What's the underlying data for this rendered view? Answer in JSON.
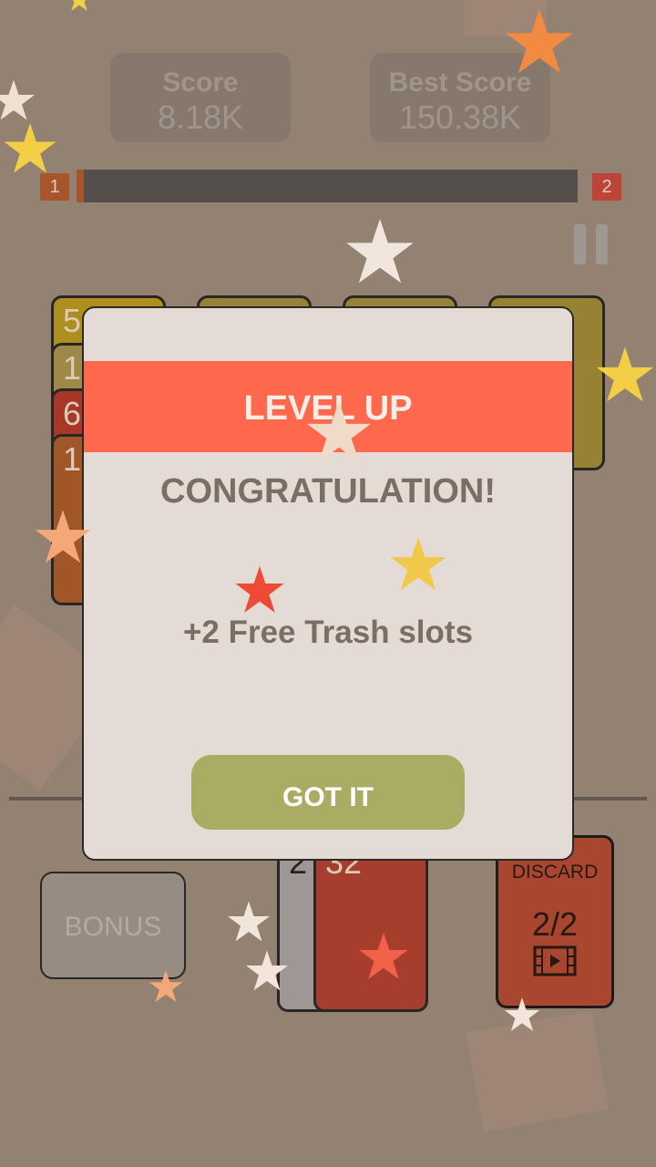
{
  "scoreboard": {
    "score_label": "Score",
    "score_value": "8.18K",
    "best_label": "Best Score",
    "best_value": "150.38K"
  },
  "level": {
    "current": "1",
    "next": "2",
    "progress_fraction": 0.015
  },
  "board_card_digits": [
    "5",
    "1",
    "6",
    "1"
  ],
  "dialog": {
    "title": "LEVEL UP",
    "heading": "CONGRATULATION!",
    "reward": "+2 Free Trash slots",
    "button": "GOT IT"
  },
  "hand": {
    "back_card_value": "2",
    "front_card_value": "32"
  },
  "bonus": {
    "label": "BONUS"
  },
  "discard": {
    "label": "DISCARD",
    "count": "2/2",
    "icon": "video-ad-icon"
  },
  "colors": {
    "banner": "#fe694e",
    "button": "#abac63",
    "background": "#9b8878",
    "discard": "#b24a32"
  }
}
